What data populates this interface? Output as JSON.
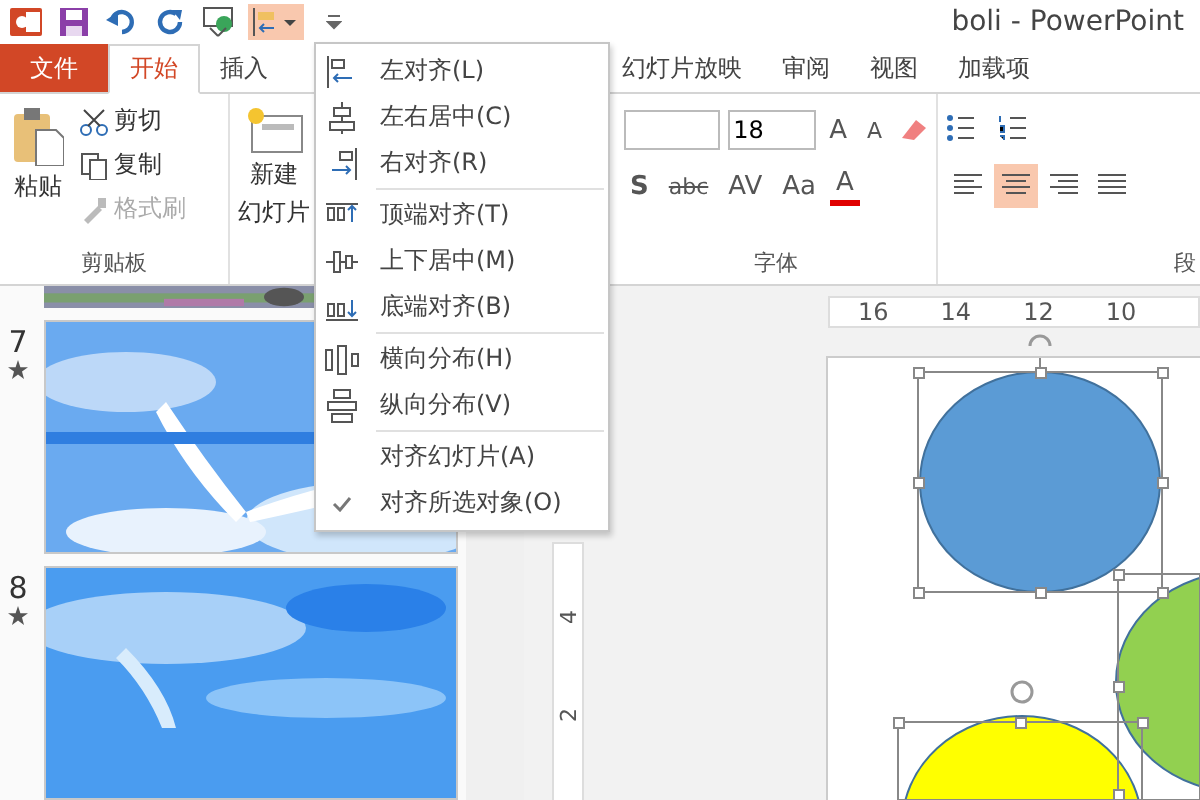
{
  "window": {
    "title": "boli - PowerPoint"
  },
  "quick_access": {
    "align_pressed": true
  },
  "tabs": [
    {
      "label": "文件",
      "kind": "file",
      "selected": false
    },
    {
      "label": "开始",
      "kind": "tab",
      "selected": true
    },
    {
      "label": "插入",
      "kind": "tab",
      "selected": false
    },
    {
      "label": "幻灯片放映",
      "kind": "tab",
      "selected": false
    },
    {
      "label": "审阅",
      "kind": "tab",
      "selected": false
    },
    {
      "label": "视图",
      "kind": "tab",
      "selected": false
    },
    {
      "label": "加载项",
      "kind": "tab",
      "selected": false
    }
  ],
  "clipboard": {
    "paste": "粘贴",
    "items": [
      {
        "label": "剪切",
        "disabled": false
      },
      {
        "label": "复制",
        "disabled": false
      },
      {
        "label": "格式刷",
        "disabled": true
      }
    ],
    "group_label": "剪贴板"
  },
  "slides_group": {
    "new_slide": [
      "新建",
      "幻灯片"
    ]
  },
  "font": {
    "size": "18",
    "grow": "A",
    "shrink": "A",
    "shadow": "S",
    "strike": "abc",
    "spacing": "AV",
    "case": "Aa",
    "color_button": "A",
    "group_label": "字体"
  },
  "paragraph": {
    "align": [
      {
        "selected": false
      },
      {
        "selected": true
      },
      {
        "selected": false
      },
      {
        "selected": false
      }
    ],
    "group_label": "段"
  },
  "align_menu": [
    {
      "label": "左对齐(L)",
      "kind": "left",
      "checked": false,
      "separator_after": false
    },
    {
      "label": "左右居中(C)",
      "kind": "center",
      "checked": false,
      "separator_after": false
    },
    {
      "label": "右对齐(R)",
      "kind": "right",
      "checked": false,
      "separator_after": true
    },
    {
      "label": "顶端对齐(T)",
      "kind": "top",
      "checked": false,
      "separator_after": false
    },
    {
      "label": "上下居中(M)",
      "kind": "middle",
      "checked": false,
      "separator_after": false
    },
    {
      "label": "底端对齐(B)",
      "kind": "bottom",
      "checked": false,
      "separator_after": true
    },
    {
      "label": "横向分布(H)",
      "kind": "hdist",
      "checked": false,
      "separator_after": false
    },
    {
      "label": "纵向分布(V)",
      "kind": "vdist",
      "checked": false,
      "separator_after": true
    },
    {
      "label": "对齐幻灯片(A)",
      "kind": "plain",
      "checked": false,
      "separator_after": false
    },
    {
      "label": "对齐所选对象(O)",
      "kind": "plain",
      "checked": true,
      "separator_after": false
    }
  ],
  "slides": [
    {
      "number": "7",
      "starred": true
    },
    {
      "number": "8",
      "starred": true
    }
  ],
  "ruler": {
    "horizontal": [
      "16",
      "14",
      "12",
      "10"
    ],
    "vertical": [
      "4",
      "2"
    ]
  }
}
